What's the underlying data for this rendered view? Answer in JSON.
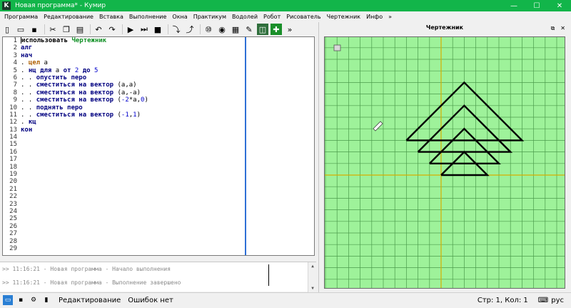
{
  "window": {
    "title": "Новая программа* - Кумир",
    "app_icon_letter": "K",
    "minimize": "—",
    "maximize": "☐",
    "close": "✕"
  },
  "menu": [
    "Программа",
    "Редактирование",
    "Вставка",
    "Выполнение",
    "Окна",
    "Практикум",
    "Водолей",
    "Робот",
    "Рисователь",
    "Чертежник",
    "Инфо",
    "»"
  ],
  "toolbar": {
    "icons": [
      "new-file-icon",
      "open-folder-icon",
      "save-icon",
      "cut-icon",
      "copy-icon",
      "paste-icon",
      "undo-icon",
      "redo-icon",
      "run-icon",
      "run-step-icon",
      "stop-icon",
      "step-into-icon",
      "step-out-icon",
      "counter-icon",
      "dolphin-icon",
      "grid-icon",
      "brush-icon",
      "drawer-icon",
      "plus-icon"
    ],
    "overflow": "»"
  },
  "editor": {
    "line_count": 29,
    "lines": [
      [
        {
          "t": "использовать ",
          "c": "kw2"
        },
        {
          "t": "Чертежник",
          "c": "mod"
        }
      ],
      [
        {
          "t": "алг",
          "c": "kw"
        }
      ],
      [
        {
          "t": "нач",
          "c": "kw"
        }
      ],
      [
        {
          "t": ". ",
          "c": ""
        },
        {
          "t": "цел",
          "c": "typ"
        },
        {
          "t": " а",
          "c": ""
        }
      ],
      [
        {
          "t": ". ",
          "c": ""
        },
        {
          "t": "нц для",
          "c": "kw"
        },
        {
          "t": " а ",
          "c": ""
        },
        {
          "t": "от",
          "c": "kw"
        },
        {
          "t": " ",
          "c": ""
        },
        {
          "t": "2",
          "c": "num"
        },
        {
          "t": " ",
          "c": ""
        },
        {
          "t": "до",
          "c": "kw"
        },
        {
          "t": " ",
          "c": ""
        },
        {
          "t": "5",
          "c": "num"
        }
      ],
      [
        {
          "t": ". . ",
          "c": ""
        },
        {
          "t": "опустить перо",
          "c": "kw"
        }
      ],
      [
        {
          "t": ". . ",
          "c": ""
        },
        {
          "t": "сместиться на вектор",
          "c": "kw"
        },
        {
          "t": " (а,а)",
          "c": ""
        }
      ],
      [
        {
          "t": ". . ",
          "c": ""
        },
        {
          "t": "сместиться на вектор",
          "c": "kw"
        },
        {
          "t": " (а,-а)",
          "c": ""
        }
      ],
      [
        {
          "t": ". . ",
          "c": ""
        },
        {
          "t": "сместиться на вектор",
          "c": "kw"
        },
        {
          "t": " (",
          "c": ""
        },
        {
          "t": "-2",
          "c": "num"
        },
        {
          "t": "*а,",
          "c": ""
        },
        {
          "t": "0",
          "c": "num"
        },
        {
          "t": ")",
          "c": ""
        }
      ],
      [
        {
          "t": ". . ",
          "c": ""
        },
        {
          "t": "поднять перо",
          "c": "kw"
        }
      ],
      [
        {
          "t": ". . ",
          "c": ""
        },
        {
          "t": "сместиться на вектор",
          "c": "kw"
        },
        {
          "t": " (",
          "c": ""
        },
        {
          "t": "-1",
          "c": "num"
        },
        {
          "t": ",",
          "c": ""
        },
        {
          "t": "1",
          "c": "num"
        },
        {
          "t": ")",
          "c": ""
        }
      ],
      [
        {
          "t": ". ",
          "c": ""
        },
        {
          "t": "кц",
          "c": "kw"
        }
      ],
      [
        {
          "t": "кон",
          "c": "kw"
        }
      ]
    ]
  },
  "console": {
    "lines": [
      ">> 11:16:21 - Новая программа - Начало выполнения",
      ">> 11:16:21 - Новая программа - Выполнение завершено"
    ]
  },
  "drawer": {
    "title": "Чертежник",
    "undock": "⧉",
    "close": "✕",
    "colors": {
      "background": "#9ef29a",
      "grid": "#4c9c4c",
      "axis": "#d4b000",
      "line": "#000000"
    }
  },
  "status": {
    "mode": "Редактирование",
    "errors": "Ошибок нет",
    "position": "Стр: 1, Кол: 1",
    "lang": "рус"
  }
}
